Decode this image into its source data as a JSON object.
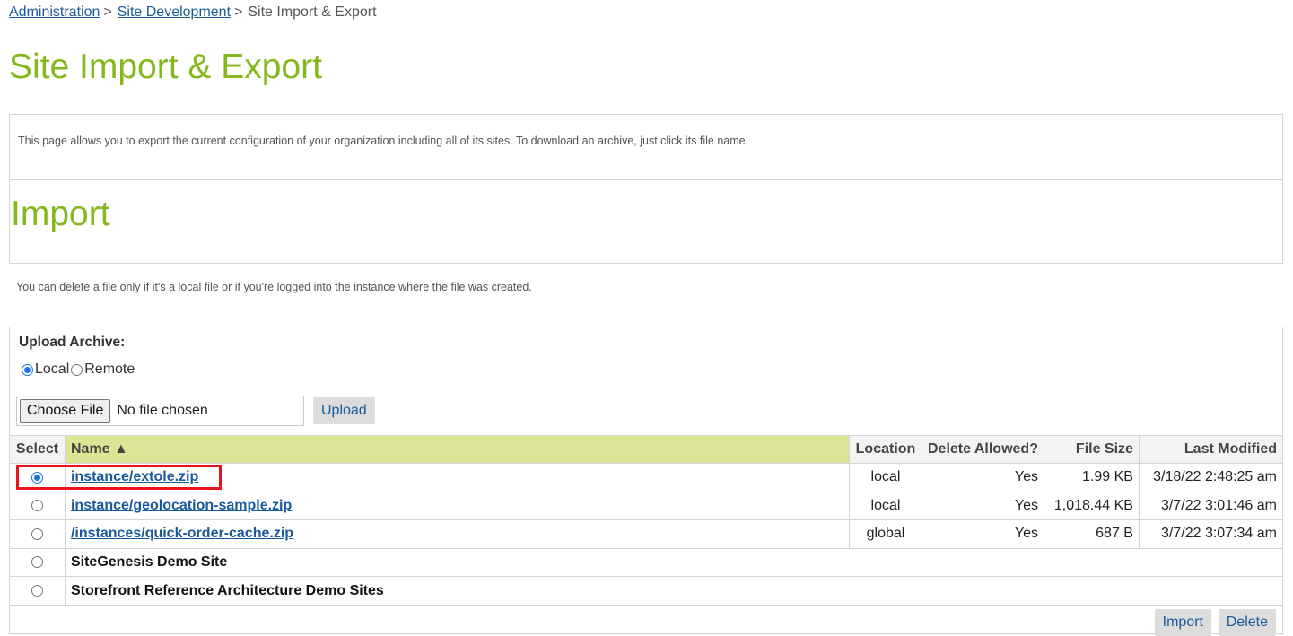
{
  "breadcrumb": {
    "items": [
      "Administration",
      "Site Development"
    ],
    "separator": ">",
    "current": "Site Import & Export"
  },
  "page_title": "Site Import & Export",
  "info": {
    "description": "This page allows you to export the current configuration of your organization including all of its sites. To download an archive, just click its file name."
  },
  "import_title": "Import",
  "delete_note": "You can delete a file only if it's a local file or if you're logged into the instance where the file was created.",
  "upload": {
    "label": "Upload Archive:",
    "options": [
      "Local",
      "Remote"
    ],
    "selected": "Local",
    "choose_file_label": "Choose File",
    "file_status": "No file chosen",
    "upload_button": "Upload"
  },
  "table": {
    "headers": {
      "select": "Select",
      "name": "Name ▲",
      "location": "Location",
      "delete_allowed": "Delete Allowed?",
      "file_size": "File Size",
      "last_modified": "Last Modified"
    },
    "rows": [
      {
        "name": "instance/extole.zip",
        "location": "local",
        "delete_allowed": "Yes",
        "size": "1.99 KB",
        "modified": "3/18/22 2:48:25 am"
      },
      {
        "name": "instance/geolocation-sample.zip",
        "location": "local",
        "delete_allowed": "Yes",
        "size": "1,018.44 KB",
        "modified": "3/7/22 3:01:46 am"
      },
      {
        "name": "/instances/quick-order-cache.zip",
        "location": "global",
        "delete_allowed": "Yes",
        "size": "687 B",
        "modified": "3/7/22 3:07:34 am"
      }
    ],
    "demo_rows": [
      "SiteGenesis Demo Site",
      "Storefront Reference Architecture Demo Sites"
    ],
    "selected_row": 0
  },
  "actions": {
    "import_button": "Import",
    "delete_button": "Delete"
  },
  "colors": {
    "title_green": "#84b81c",
    "link_blue": "#1a5a9a",
    "sorted_header": "#dce595",
    "highlight_red": "#e8141c"
  }
}
